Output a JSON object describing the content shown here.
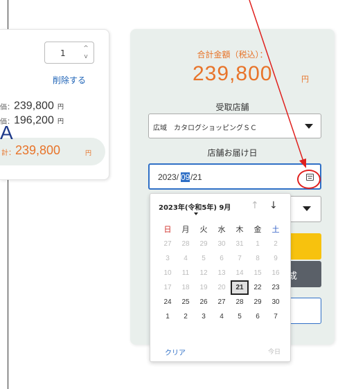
{
  "cart": {
    "quantity": "1",
    "delete_label": "削除する",
    "price_rows": [
      {
        "label": "価：",
        "value": "239,800",
        "yen": "円"
      },
      {
        "label": "価：",
        "value": "196,200",
        "yen": "円"
      }
    ],
    "subtotal": {
      "label": "計：",
      "value": "239,800",
      "yen": "円"
    },
    "stray_char": "A"
  },
  "summary": {
    "total_label": "合計金額（税込）：",
    "total_amount": "239,800",
    "total_yen": "円",
    "pickup_store_label": "受取店舗",
    "pickup_store_value": "広域　カタログショッピングＳＣ",
    "delivery_date_label": "店舗お届け日",
    "delivery_date": {
      "year": "2023/",
      "month": "09",
      "day": "/21"
    },
    "gray_button_partial": "成"
  },
  "calendar": {
    "title": "2023年(令和5年) 9月",
    "weekdays": [
      "日",
      "月",
      "火",
      "水",
      "木",
      "金",
      "土"
    ],
    "weeks": [
      [
        "27",
        "28",
        "29",
        "30",
        "31",
        "1",
        "2"
      ],
      [
        "3",
        "4",
        "5",
        "6",
        "7",
        "8",
        "9"
      ],
      [
        "10",
        "11",
        "12",
        "13",
        "14",
        "15",
        "16"
      ],
      [
        "17",
        "18",
        "19",
        "20",
        "21",
        "22",
        "23"
      ],
      [
        "24",
        "25",
        "26",
        "27",
        "28",
        "29",
        "30"
      ],
      [
        "1",
        "2",
        "3",
        "4",
        "5",
        "6",
        "7"
      ]
    ],
    "selected_day": "21",
    "clear_label": "クリア",
    "today_label": "今日"
  },
  "colors": {
    "accent_orange": "#e8742a",
    "link_blue": "#1e63b7",
    "focus_blue": "#2f6fc6",
    "panel_bg": "#e9efec",
    "annotation_red": "#e0201e",
    "primary_yellow": "#f7c20e",
    "dark_gray": "#5a6068"
  },
  "icons": {
    "calendar": "calendar-icon",
    "qty_stepper": "up-down-arrows",
    "select_caret": "triangle-down"
  }
}
